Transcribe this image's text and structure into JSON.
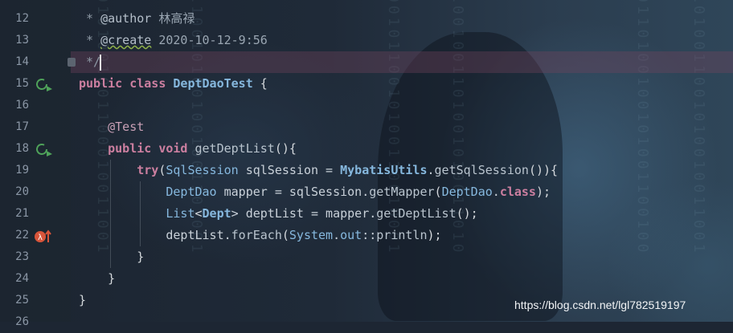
{
  "watermark": "https://blog.csdn.net/lgl782519197",
  "colors": {
    "keyword": "#cc7fa0",
    "class_name": "#86b8de",
    "annotation": "#c9a0b6",
    "comment": "#8d98a4",
    "run_icon": "#4fa35a",
    "error_icon": "#d8553a"
  },
  "gutter_icons": {
    "run_class": "run-test-icon",
    "run_method": "run-test-icon",
    "exception": "exception-lambda-icon"
  },
  "lines": [
    {
      "num": "12",
      "parts": [
        " * ",
        "@author",
        " 林高禄"
      ]
    },
    {
      "num": "13",
      "parts": [
        " * ",
        "@create",
        " 2020-10-12-9:56"
      ]
    },
    {
      "num": "14",
      "parts": [
        " */"
      ]
    },
    {
      "num": "15",
      "parts": [
        "public",
        " ",
        "class",
        " ",
        "DeptDaoTest",
        " {"
      ]
    },
    {
      "num": "16",
      "parts": []
    },
    {
      "num": "17",
      "parts": [
        "    ",
        "@Test"
      ]
    },
    {
      "num": "18",
      "parts": [
        "    ",
        "public",
        " ",
        "void",
        " ",
        "getDeptList",
        "(){"
      ]
    },
    {
      "num": "19",
      "parts": [
        "        ",
        "try",
        "(",
        "SqlSession",
        " sqlSession = ",
        "MybatisUtils",
        ".",
        "getSqlSession",
        "()){"
      ]
    },
    {
      "num": "20",
      "parts": [
        "            ",
        "DeptDao",
        " mapper = sqlSession.",
        "getMapper",
        "(",
        "DeptDao",
        ".",
        "class",
        ");"
      ]
    },
    {
      "num": "21",
      "parts": [
        "            ",
        "List",
        "<",
        "Dept",
        "> deptList = mapper.",
        "getDeptList",
        "();"
      ]
    },
    {
      "num": "22",
      "parts": [
        "            ",
        "deptList.",
        "forEach",
        "(",
        "System",
        ".",
        "out",
        "::",
        "println",
        ");"
      ]
    },
    {
      "num": "23",
      "parts": [
        "        ",
        "}"
      ]
    },
    {
      "num": "24",
      "parts": [
        "    ",
        "}"
      ]
    },
    {
      "num": "25",
      "parts": [
        "}"
      ]
    },
    {
      "num": "26",
      "parts": []
    }
  ]
}
